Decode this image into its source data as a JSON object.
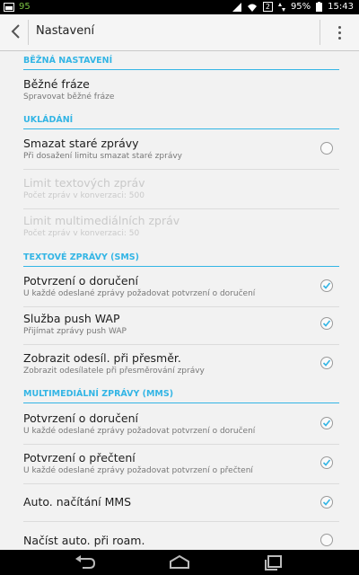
{
  "status": {
    "notification": "95",
    "battery": "95%",
    "time": "15:43",
    "sim": "2"
  },
  "appbar": {
    "title": "Nastavení"
  },
  "sections": {
    "common": "BĚŽNÁ NASTAVENÍ",
    "storage": "UKLÁDÁNÍ",
    "sms": "TEXTOVÉ ZPRÁVY (SMS)",
    "mms": "MULTIMEDIÁLNÍ ZPRÁVY (MMS)"
  },
  "items": {
    "phrases": {
      "title": "Běžné fráze",
      "summary": "Spravovat běžné fráze"
    },
    "delete_old": {
      "title": "Smazat staré zprávy",
      "summary": "Při dosažení limitu smazat staré zprávy",
      "checked": false
    },
    "text_limit": {
      "title": "Limit textových zpráv",
      "summary": "Počet zpráv v konverzaci: 500"
    },
    "mms_limit": {
      "title": "Limit multimediálních zpráv",
      "summary": "Počet zpráv v konverzaci: 50"
    },
    "sms_delivery": {
      "title": "Potvrzení o doručení",
      "summary": "U každé odeslané zprávy požadovat potvrzení o doručení",
      "checked": true
    },
    "push_wap": {
      "title": "Služba push WAP",
      "summary": "Přijímat zprávy push WAP",
      "checked": true
    },
    "show_sender": {
      "title": "Zobrazit odesíl. při přesměr.",
      "summary": "Zobrazit odesílatele při přesměrování zprávy",
      "checked": true
    },
    "mms_delivery": {
      "title": "Potvrzení o doručení",
      "summary": "U každé odeslané zprávy požadovat potvrzení o doručení",
      "checked": true
    },
    "mms_read": {
      "title": "Potvrzení o přečtení",
      "summary": "U každé odeslané zprávy požadovat potvrzení o přečtení",
      "checked": true
    },
    "auto_mms": {
      "title": "Auto. načítání MMS",
      "checked": true
    },
    "roam": {
      "title": "Načíst auto. při roam.",
      "checked": false
    }
  },
  "colors": {
    "accent": "#33b5e5",
    "statusbar": "#000000",
    "background": "#f2f2f2"
  }
}
